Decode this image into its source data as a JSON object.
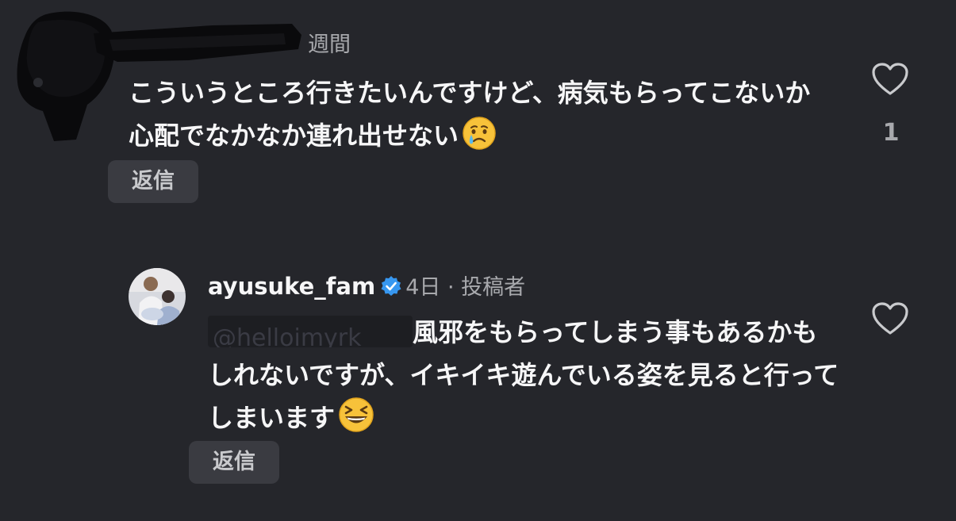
{
  "comment_1": {
    "meta": "週間",
    "text": "こういうところ行きたいんですけど、病気もらってこないか心配でなかなか連れ出せない",
    "emoji": "crying-face-emoji",
    "reply_label": "返信",
    "like_count": "1"
  },
  "comment_2": {
    "username": "ayusuke_fam",
    "meta": "4日 · 投稿者",
    "mention": "@helloimyrk",
    "text": "風邪をもらってしまう事もあるかもしれないですが、イキイキ遊んでいる姿を見ると行ってしまいます",
    "emoji": "grinning-squinting-face-emoji",
    "reply_label": "返信"
  },
  "colors": {
    "background": "#25262b",
    "text_primary": "#f6f6f7",
    "text_secondary": "#a8a9ad",
    "reply_button_bg": "#3a3b41",
    "verified_badge": "#3797f0"
  },
  "icons": [
    "heart-icon",
    "verified-badge-icon"
  ]
}
